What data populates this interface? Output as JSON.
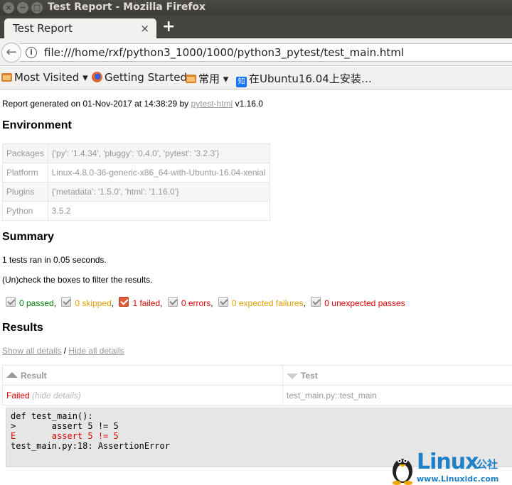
{
  "window": {
    "title": "Test Report - Mozilla Firefox"
  },
  "tab": {
    "title": "Test Report",
    "close": "×"
  },
  "toolbar": {
    "new_tab": "+",
    "back": "←",
    "url": "file:///home/rxf/python3_1000/1000/python3_pytest/test_main.html"
  },
  "bookmarks": [
    {
      "label": "Most Visited",
      "chevron": "▾"
    },
    {
      "label": "Getting Started"
    },
    {
      "label": "常用",
      "chevron": "▾"
    },
    {
      "label": "在Ubuntu16.04上安装…"
    }
  ],
  "report": {
    "generated_prefix": "Report generated on 01-Nov-2017 at 14:38:29 by",
    "generator_link": "pytest-html",
    "generator_version": "v1.16.0"
  },
  "environment": {
    "heading": "Environment",
    "rows": [
      {
        "key": "Packages",
        "value": "{'py': '1.4.34', 'pluggy': '0.4.0', 'pytest': '3.2.3'}"
      },
      {
        "key": "Platform",
        "value": "Linux-4.8.0-36-generic-x86_64-with-Ubuntu-16.04-xenial"
      },
      {
        "key": "Plugins",
        "value": "{'metadata': '1.5.0', 'html': '1.16.0'}"
      },
      {
        "key": "Python",
        "value": "3.5.2"
      }
    ]
  },
  "summary": {
    "heading": "Summary",
    "ran": "1 tests ran in 0.05 seconds.",
    "filter_hint": "(Un)check the boxes to filter the results.",
    "filters": [
      {
        "label": "0 passed",
        "sep": ",",
        "cls": "passed"
      },
      {
        "label": "0 skipped",
        "sep": ",",
        "cls": "skipped"
      },
      {
        "label": "1 failed",
        "sep": ",",
        "cls": "failed"
      },
      {
        "label": "0 errors",
        "sep": ",",
        "cls": "error"
      },
      {
        "label": "0 expected failures",
        "sep": ",",
        "cls": "xfailed"
      },
      {
        "label": "0 unexpected passes",
        "sep": "",
        "cls": "xpassed"
      }
    ]
  },
  "results": {
    "heading": "Results",
    "show_all": "Show all details",
    "sep": "/",
    "hide_all": "Hide all details",
    "col_result": "Result",
    "col_test": "Test",
    "row": {
      "result": "Failed",
      "hide": "(hide details)",
      "test": "test_main.py::test_main"
    },
    "log": [
      "def test_main():",
      ">       assert 5 != 5",
      "E       assert 5 != 5",
      "",
      "test_main.py:18: AssertionError"
    ]
  },
  "watermark": {
    "brand": "Linux",
    "cn": "公社",
    "url": "www.Linuxidc.com"
  },
  "colors": {
    "passed": "#008000",
    "failed": "#e00000",
    "skipped": "#e0a000",
    "titlebar": "#3c3b37"
  }
}
